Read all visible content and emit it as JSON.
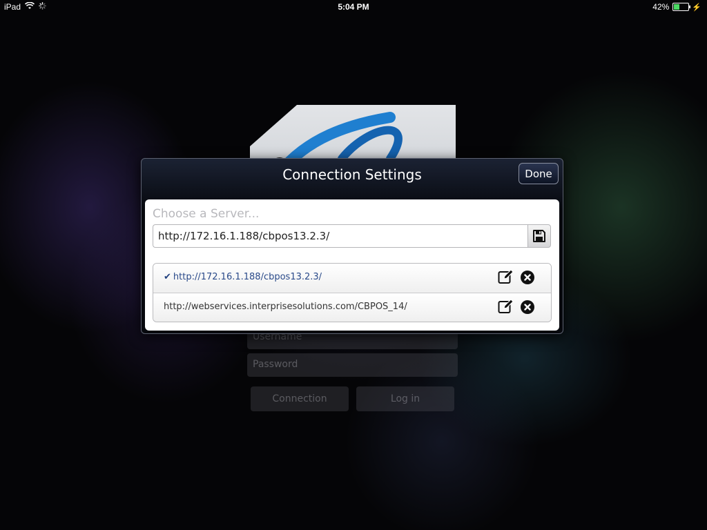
{
  "statusbar": {
    "device": "iPad",
    "time": "5:04 PM",
    "battery_percent": "42%",
    "battery_level": 0.42,
    "icons": [
      "wifi-icon",
      "spinner-icon",
      "battery-icon",
      "bolt-icon"
    ]
  },
  "background_form": {
    "username_placeholder": "Username",
    "password_placeholder": "Password",
    "connection_button": "Connection",
    "login_button": "Log in"
  },
  "dialog": {
    "title": "Connection Settings",
    "done_label": "Done",
    "choose_label": "Choose a Server...",
    "url_value": "http://172.16.1.188/cbpos13.2.3/",
    "save_icon": "save-icon",
    "servers": [
      {
        "url": "http://172.16.1.188/cbpos13.2.3/",
        "selected": true
      },
      {
        "url": "http://webservices.interprisesolutions.com/CBPOS_14/",
        "selected": false
      }
    ]
  },
  "colors": {
    "accent": "#1f3f7e",
    "battery": "#4cd964",
    "logo_blue": "#1f7fd0"
  }
}
